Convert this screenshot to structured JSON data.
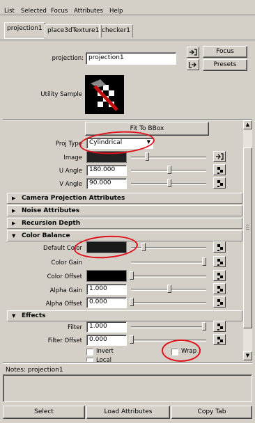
{
  "menu": [
    "List",
    "Selected",
    "Focus",
    "Attributes",
    "Help"
  ],
  "tabs": [
    "projection1",
    "place3dTexture1",
    "checker1"
  ],
  "header": {
    "projection_label": "projection:",
    "projection_value": "projection1",
    "focus_label": "Focus",
    "presets_label": "Presets",
    "utility_label": "Utility Sample"
  },
  "proj_attrs": {
    "fit_bbox": "Fit To BBox",
    "proj_type_label": "Proj Type",
    "proj_type_value": "Cylindrical",
    "image_label": "Image",
    "u_angle_label": "U Angle",
    "u_angle_value": "180.000",
    "v_angle_label": "V Angle",
    "v_angle_value": "90.000"
  },
  "sections": {
    "camera": "Camera Projection Attributes",
    "noise": "Noise Attributes",
    "recursion": "Recursion Depth",
    "color_balance": "Color Balance",
    "effects": "Effects"
  },
  "color_balance": {
    "default_color": "Default Color",
    "color_gain": "Color Gain",
    "color_offset": "Color Offset",
    "alpha_gain": "Alpha Gain",
    "alpha_gain_value": "1.000",
    "alpha_offset": "Alpha Offset",
    "alpha_offset_value": "0.000"
  },
  "effects": {
    "filter_label": "Filter",
    "filter_value": "1.000",
    "filter_offset_label": "Filter Offset",
    "filter_offset_value": "0.000",
    "invert": "Invert",
    "wrap": "Wrap",
    "local": "Local"
  },
  "notes_label": "Notes: projection1",
  "footer": {
    "select": "Select",
    "load": "Load Attributes",
    "copy": "Copy Tab"
  },
  "colors": {
    "background": "#d4d0c8",
    "annotation": "#e0101a"
  }
}
